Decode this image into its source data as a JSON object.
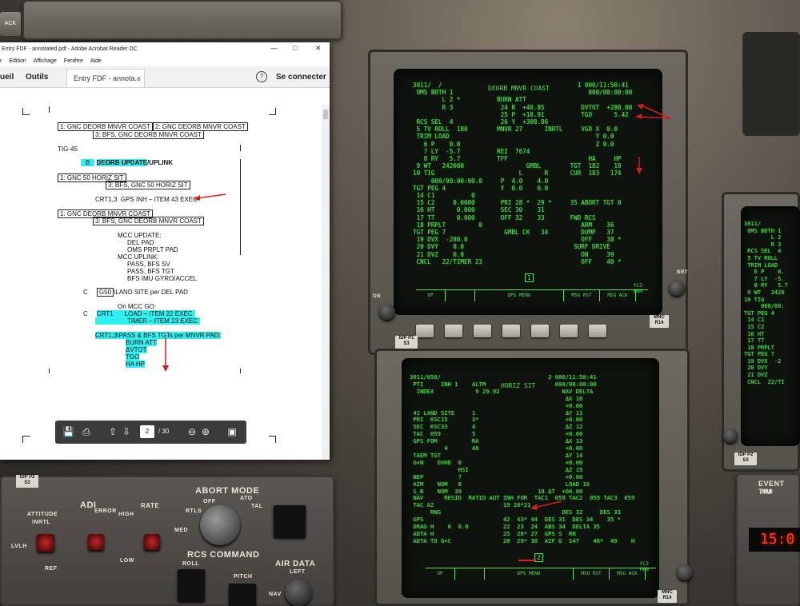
{
  "window": {
    "title": "Entry FDF - annotated.pdf - Adobe Acrobat Reader DC",
    "menu": [
      "Edition",
      "Affichage",
      "Fenêtre",
      "Aide"
    ],
    "menu_partial": "r",
    "nav_home": "ueil",
    "nav_tools": "Outils",
    "doc_tab": "Entry FDF - annota...",
    "doc_tab_close": "×",
    "help": "?",
    "sign_in": "Se connecter",
    "page_current": "2",
    "page_total": "/ 30"
  },
  "ack_button": "ACK",
  "document": {
    "l1a": "1:  GNC DEORB MNVR COAST",
    "l1b": "2:  GNC DEORB MNVR COAST",
    "l1c": "3:  BFS, GNC DEORB MNVR COAST",
    "tig": "TIG-45",
    "b_tag": "B",
    "deorb_update": "DEORB UPDATE",
    "uplink": "/UPLINK",
    "l2a": "1:  GNC 50 HORIZ SIT",
    "l2b": "3:  BFS, GNC 50 HORIZ SIT",
    "crt13": "CRT1,3",
    "gps_inh": "GPS INH – ITEM 43 EXEC",
    "l3a": "1:  GNC DEORB MNVR COAST",
    "l3b": "3:  BFS, GNC DEORB MNVR COAST",
    "mcc_update": "MCC UPDATE:",
    "del_pad": "DEL PAD",
    "oms_prplt_pad": "OMS PRPLT PAD",
    "mcc_uplink": "MCC UPLINK:",
    "pass_bfs_sv": "PASS, BFS SV",
    "pass_bfs_tgt": "PASS, BFS TGT",
    "bfs_imu": "BFS IMU GYRO/ACCEL",
    "c1": "C",
    "g50": "G50",
    "land_site": "\\LAND SITE per DEL PAD",
    "on_mcc_go": "On MCC GO:",
    "c2": "C",
    "crt1": "CRT1",
    "load_item": "LOAD  – ITEM 22 EXEC",
    "timer_item": "TIMER – ITEM 23 EXEC",
    "crt13b": "CRT1,3",
    "pass_bfs_tgts": "\\PASS & BFS TGTs per MNVR PAD:",
    "burn_att": "BURN ATT",
    "dvtot": "ΔVTOT",
    "tgo": "TGO",
    "ha_hp": "HA HP"
  },
  "crt_upper": {
    "title": "DEORB MNVR COAST",
    "text": "3011/  /                                     1 000/11:50:41\n OMS BOTH 1                                     000/00:00:00\n        L 2 *          BURN ATT\n        R 3             24 R  +40.85          DVTOT  +280.00\n                        25 P  +18.91          TGO      5.42\n RCS SEL  4             26 Y  +308.86\n 5 TV ROLL  180        MNVR 27      INRTL     VGO X  0.0\n TRIM LOAD                                        Y 0.0\n   6 P    0.0                                     Z 0.0\n   7 LY  -5.7          REI  7674\n   8 RY   5.7          TFF                      HA     HP\n 9 WT   242000                 GMBL        TGT  182    19\n10 TIG                       L      R      CUR  183   174\n     000/00:00:00.0     P  4.0    4.0\nTGT PEG 4               Y  0.0    0.0\n 14 C1          0\n 15 C2     0.0000       PRI 28 *  29 *     35 ABORT TGT 0\n 16 HT      0.000       SEC 30    31\n 17 TT      0.000       OFF 32    33       FWD RCS\n 18 PRPLT         0                           ARM    36\nTGT PEG 7                GMBL CK   34         DUMP   37\n 19 DVX  -280.0                               OFF    38 *\n 20 DVY    0.0                              SURF DRIVE\n 21 DVZ    0.0                                ON     39\n CNCL   22/TIMER 23                           OFF    40 *",
    "page_num": "1",
    "softkeys": [
      "UP",
      "DPS MENU",
      "MSG RST",
      "MSG ACK"
    ],
    "fc": "FC3\nMAN"
  },
  "crt_lower": {
    "title": "HORIZ SIT",
    "text": "3011/050/                               2 000/11:50:41\n PTI     INH 1    ALTM                    000/00:00:00\n  INDEX            9 29.92                  NAV DELTA\n                                             ΔX 10\n                                             +0.00\n 41 LAND SITE     1                          ΔY 11\n PRI  KSC15       3*                         +0.00\n SEC  KSC33       4                          ΔZ 12\n TAC  059         5                          +0.00\n GPS FOM          RA                         ΔX 13\n          4       46                         +0.00\n TAEM TGT                                    ΔY 14\n G+N    OVHD  6                              +0.00\n              HSI                            ΔZ 15\n NEP          7                              +0.00\n AIM    NOM   8                              LOAD 16\n S_B    NOM  39                      18 ΔT  +00.00\n NAV      RESID  RATIO AUT INH FOR  TAC1  059 TAC2  059 TAC3  059\n TAC AZ                    19 20*21\n      RNG                                   DES 32     DES 33\n GPS                       42  43* 44  DES 31  DES 34    35 *\n DRAG H    0  0.0          22  23  24  ABS 34  DELTA 35\n ADTA H                    25  26* 27  GPS S  RN\n ADTA TO G+C               28  29* 30  AIF G  S47    48*  49    H",
    "page_num": "2",
    "softkeys": [
      "UP",
      "DPS MENU",
      "MSG RST",
      "MSG ACK"
    ],
    "fc": "FC3\nMAN"
  },
  "crt_right": {
    "text": "3011/\n OMS BOTH 1\n        L 2\n        R 3\n RCS SEL  4\n 5 TV ROLL\n TRIM LOAD\n   6 P    0.\n   7 LY  -5.\n   8 RY   5.7\n 9 WT   2420\n10 TIG\n     000/00:\nTGT PEG 4\n 14 C1\n 15 C2\n 16 HT\n 17 TT\n 18 PRPLT\nTGT PEG 7\n 19 DVX  -2\n 20 DVY\n 21 DVZ\n CNCL  22/TI"
  },
  "panel_labels": {
    "abort_mode": "ABORT MODE",
    "rcs_command": "RCS COMMAND",
    "air_data": "AIR DATA",
    "left": "LEFT",
    "adi": "ADI",
    "attitude": "ATTITUDE",
    "inrtl": "INRTL",
    "lvlh": "LVLH",
    "ref": "REF",
    "error": "ERROR",
    "rate": "RATE",
    "high": "HIGH",
    "low": "LOW",
    "med": "MED",
    "off": "OFF",
    "ato": "ATO",
    "rtls": "RTLS",
    "tal": "TAL",
    "roll": "ROLL",
    "pitch": "PITCH",
    "nav": "NAV",
    "event_timer": "EVENT TIM",
    "min": "MIN",
    "timer_digits": "15:0",
    "on": "ON",
    "off2": "OFF",
    "idp1": "IDP P1\nS3",
    "idp2": "IDP P2\nS3",
    "mnc1": "MNC\nR14",
    "mnc2": "MNC\nR14",
    "brt": "BRT"
  }
}
